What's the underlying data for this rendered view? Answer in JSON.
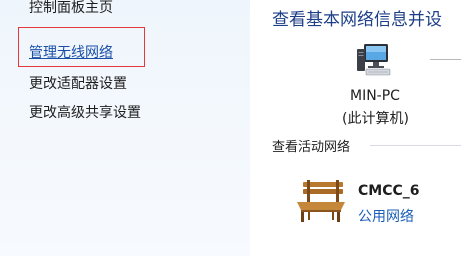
{
  "sidebar": {
    "title": "控制面板主页",
    "links": [
      {
        "label": "管理无线网络"
      },
      {
        "label": "更改适配器设置"
      },
      {
        "label": "更改高级共享设置"
      }
    ]
  },
  "main": {
    "heading": "查看基本网络信息并设",
    "computer": {
      "name": "MIN-PC",
      "subtitle": "(此计算机)",
      "icon": "computer-icon"
    },
    "active_networks": {
      "title": "查看活动网络",
      "network": {
        "name": "CMCC_6",
        "type": "公用网络",
        "icon": "bench-icon"
      }
    }
  },
  "colors": {
    "link_blue": "#1a5fb8",
    "heading_blue": "#1c3f87",
    "highlight_red": "#e23838",
    "sidebar_bg": "#eef5fc"
  }
}
